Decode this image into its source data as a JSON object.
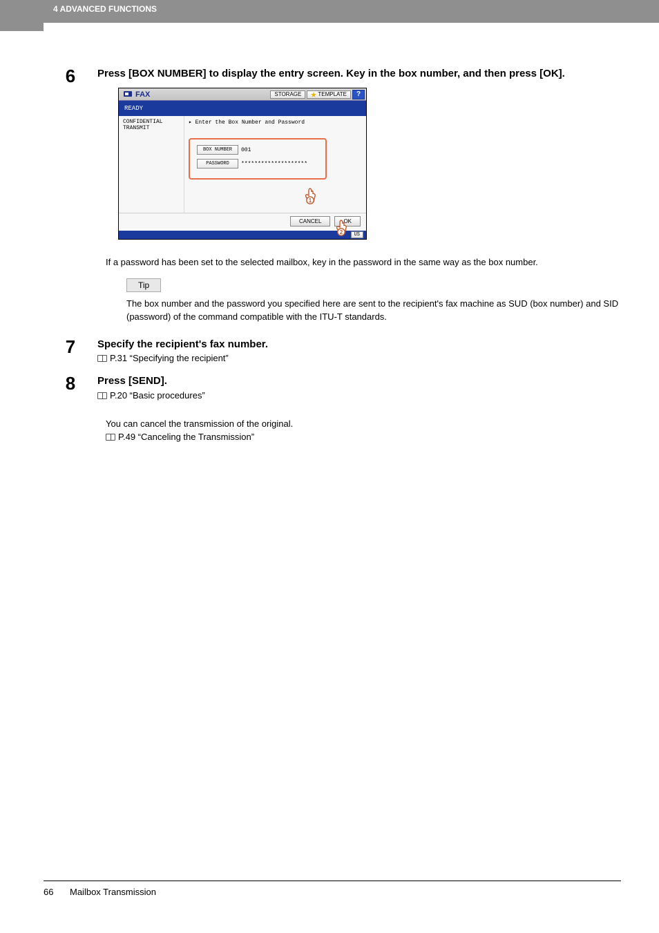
{
  "header": {
    "chapter": "4 ADVANCED FUNCTIONS"
  },
  "steps": {
    "s6": {
      "num": "6",
      "title": "Press [BOX NUMBER] to display the entry screen. Key in the box number, and then press [OK]."
    },
    "s7": {
      "num": "7",
      "title": "Specify the recipient's fax number.",
      "ref": "P.31 “Specifying the recipient”"
    },
    "s8": {
      "num": "8",
      "title": "Press [SEND].",
      "ref": "P.20 “Basic procedures”"
    }
  },
  "fax": {
    "title": "FAX",
    "storage": "STORAGE",
    "template": "TEMPLATE",
    "help": "?",
    "ready": "READY",
    "side": "CONFIDENTIAL TRANSMIT",
    "instruction": "▸ Enter the Box Number and Password",
    "box_label": "BOX NUMBER",
    "box_value": "001",
    "pwd_label": "PASSWORD",
    "pwd_value": "********************",
    "cancel": "CANCEL",
    "ok": "OK",
    "status_btn": "US",
    "pointer1": "1",
    "pointer2": "2"
  },
  "after_shot": "If a password has been set to the selected mailbox, key in the password in the same way as the box number.",
  "tip": {
    "label": "Tip",
    "text": "The box number and the password you specified here are sent to the recipient's fax machine as SUD (box number) and SID (password) of the command compatible with the ITU-T standards."
  },
  "cancel_block": {
    "line": "You can cancel the transmission of the original.",
    "ref": "P.49 “Canceling the Transmission”"
  },
  "footer": {
    "page": "66",
    "title": "Mailbox Transmission"
  }
}
